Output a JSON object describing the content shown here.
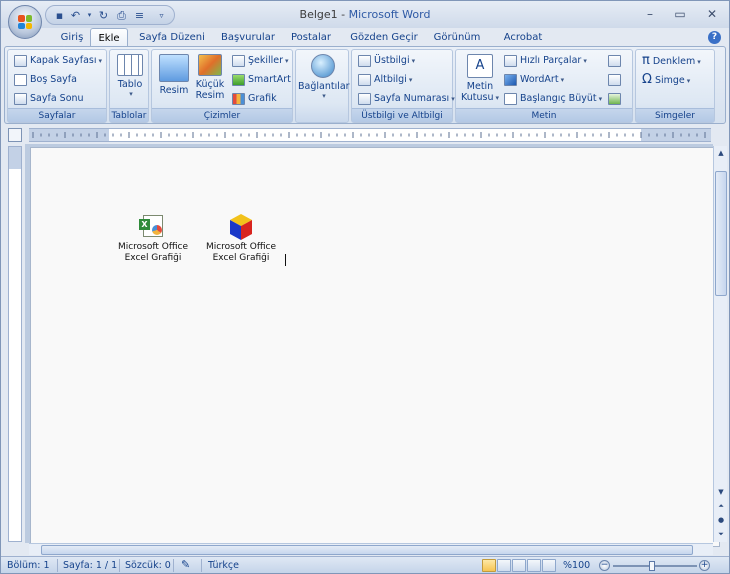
{
  "window": {
    "doc_name": "Belge1",
    "separator": " - ",
    "app_name": "Microsoft Word",
    "controls": {
      "minimize": "–",
      "maximize": "▭",
      "close": "✕"
    }
  },
  "tabs": [
    "Giriş",
    "Ekle",
    "Sayfa Düzeni",
    "Başvurular",
    "Postalar",
    "Gözden Geçir",
    "Görünüm",
    "Acrobat"
  ],
  "active_tab": "Ekle",
  "ribbon": {
    "groups": {
      "sayfalar": {
        "label": "Sayfalar",
        "items": [
          "Kapak Sayfası",
          "Boş Sayfa",
          "Sayfa Sonu"
        ]
      },
      "tablolar": {
        "label": "Tablolar",
        "items": [
          "Tablo"
        ]
      },
      "cizimler": {
        "label": "Çizimler",
        "resim": "Resim",
        "kucuk_line1": "Küçük",
        "kucuk_line2": "Resim",
        "sekiller": "Şekiller",
        "smartart": "SmartArt",
        "grafik": "Grafik"
      },
      "baglantilar": {
        "label": "Bağlantılar"
      },
      "ustbilgi": {
        "label": "Üstbilgi ve Altbilgi",
        "items": [
          "Üstbilgi",
          "Altbilgi",
          "Sayfa Numarası"
        ]
      },
      "metin": {
        "label": "Metin",
        "kutusu_line1": "Metin",
        "kutusu_line2": "Kutusu",
        "hizli": "Hızlı Parçalar",
        "wordart": "WordArt",
        "baslangic": "Başlangıç Büyüt"
      },
      "simgeler": {
        "label": "Simgeler",
        "denklem": "Denklem",
        "simge": "Simge"
      }
    }
  },
  "document": {
    "objects": [
      {
        "line1": "Microsoft Office",
        "line2": "Excel Grafiği"
      },
      {
        "line1": "Microsoft Office",
        "line2": "Excel Grafiği"
      }
    ]
  },
  "status": {
    "section": "Bölüm: 1",
    "page": "Sayfa: 1 / 1",
    "words": "Sözcük: 0",
    "language": "Türkçe",
    "zoom": "%100",
    "zoom_fraction": 0.5
  },
  "colors": {
    "accent": "#15428b",
    "title_app": "#2e5aa5",
    "active_view": "#f6c452"
  }
}
